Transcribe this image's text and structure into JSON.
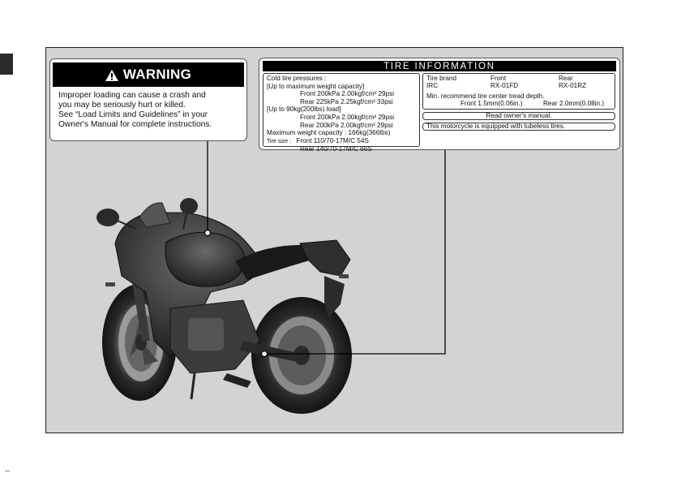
{
  "warning": {
    "title": "WARNING",
    "lines": [
      "Improper loading can cause a crash and",
      "you may be seriously hurt or killed.",
      "See “Load Limits and Guidelines” in your",
      "Owner's Manual for complete instructions."
    ]
  },
  "tire_info": {
    "title": "TIRE INFORMATION",
    "left_lines": [
      {
        "text": "Cold tire pressures :",
        "indent": false
      },
      {
        "text": "[Up to maximum weight capacity]",
        "indent": false
      },
      {
        "text": "Front 200kPa 2.00kgf/cm² 29psi",
        "indent": true
      },
      {
        "text": "Rear  225kPa 2.25kgf/cm² 33psi",
        "indent": true
      },
      {
        "text": "[Up to 90kg(200lbs) load]",
        "indent": false
      },
      {
        "text": "Front 200kPa 2.00kgf/cm² 29psi",
        "indent": true
      },
      {
        "text": "Rear  200kPa 2.00kgf/cm² 29psi",
        "indent": true
      },
      {
        "text": "Maximum weight capacity : 166kg(366lbs)",
        "indent": false
      }
    ],
    "tire_size_label": "Tire size :",
    "tire_size_front": "Front  110/70-17M/C 54S",
    "tire_size_rear": "Rear  140/70-17M/C 66S",
    "brand_label": "Tire brand",
    "front_label": "Front",
    "rear_label": "Rear",
    "brand_value": "IRC",
    "front_value": "RX-01FD",
    "rear_value": "RX-01RZ",
    "tread_label": "Min. recommend tire center tread depth.",
    "tread_front": "Front  1.5mm(0.06in.)",
    "tread_rear": "Rear  2.0mm(0.08in.)",
    "read_manual": "Read owner's manual.",
    "tubeless": "This motorcycle is equipped with tubeless tires."
  }
}
